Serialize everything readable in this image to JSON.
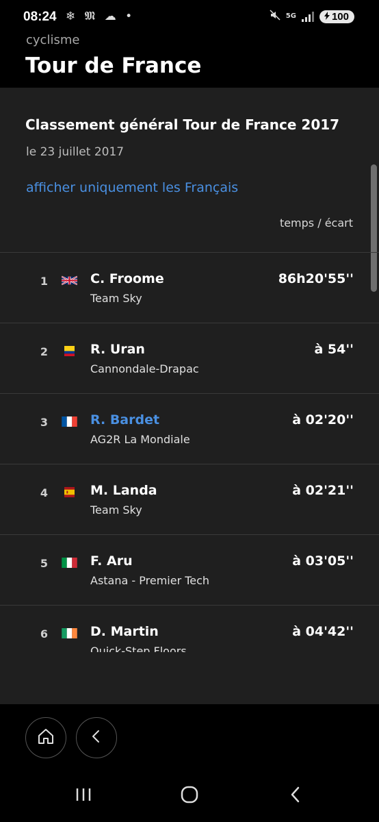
{
  "status_bar": {
    "time": "08:24",
    "notifications": "❄ 𝕸 ☁ •",
    "network": "5G",
    "battery": "100"
  },
  "header": {
    "subtitle": "cyclisme",
    "title": "Tour de France"
  },
  "ranking": {
    "title": "Classement général Tour de France 2017",
    "date": "le 23 juillet 2017",
    "filter_link": "afficher uniquement les Français",
    "column_header": "temps / écart",
    "rows": [
      {
        "rank": "1",
        "flag": "gb",
        "rider": "C. Froome",
        "team": "Team Sky",
        "gap": "86h20'55''",
        "highlight": false
      },
      {
        "rank": "2",
        "flag": "co",
        "rider": "R. Uran",
        "team": "Cannondale-Drapac",
        "gap": "à 54''",
        "highlight": false
      },
      {
        "rank": "3",
        "flag": "fr",
        "rider": "R. Bardet",
        "team": "AG2R La Mondiale",
        "gap": "à 02'20''",
        "highlight": true
      },
      {
        "rank": "4",
        "flag": "es",
        "rider": "M. Landa",
        "team": "Team Sky",
        "gap": "à 02'21''",
        "highlight": false
      },
      {
        "rank": "5",
        "flag": "it",
        "rider": "F. Aru",
        "team": "Astana - Premier Tech",
        "gap": "à 03'05''",
        "highlight": false
      },
      {
        "rank": "6",
        "flag": "ie",
        "rider": "D. Martin",
        "team": "Quick-Step Floors",
        "gap": "à 04'42''",
        "highlight": false
      }
    ]
  },
  "app_nav": {
    "home_icon": "home-icon",
    "back_icon": "chevron-left-icon"
  },
  "colors": {
    "background": "#000000",
    "content_bg": "#1f1f1f",
    "accent": "#4a90e2",
    "divider": "#3a3a3a"
  }
}
